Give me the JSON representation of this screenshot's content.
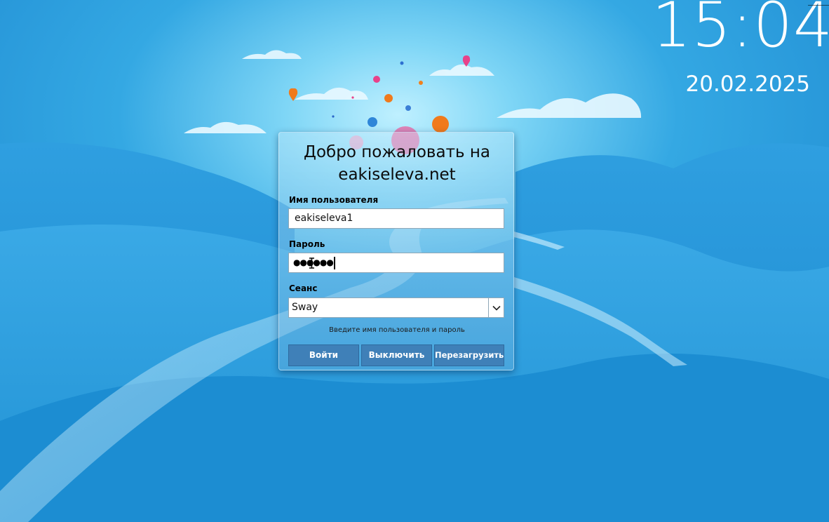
{
  "clock": {
    "time": "15:04",
    "date": "20.02.2025"
  },
  "login": {
    "welcome_title_line1": "Добро пожаловать на",
    "welcome_title_line2": "eakiseleva.net",
    "username": {
      "label": "Имя пользователя",
      "value": "eakiseleva1"
    },
    "password": {
      "label": "Пароль",
      "value_masked": "●●●●●●"
    },
    "session": {
      "label": "Сеанс",
      "selected": "Sway"
    },
    "status_message": "Введите имя пользователя и пароль",
    "buttons": {
      "login": "Войти",
      "shutdown": "Выключить",
      "reboot": "Перезагрузить"
    }
  },
  "icons": {
    "session_dropdown": "chevron-down-icon",
    "text_cursor": "ibeam-cursor-icon"
  },
  "colors": {
    "background": "#1a8fd3",
    "button": "#3f80b8",
    "clock_text": "#ffffff"
  }
}
